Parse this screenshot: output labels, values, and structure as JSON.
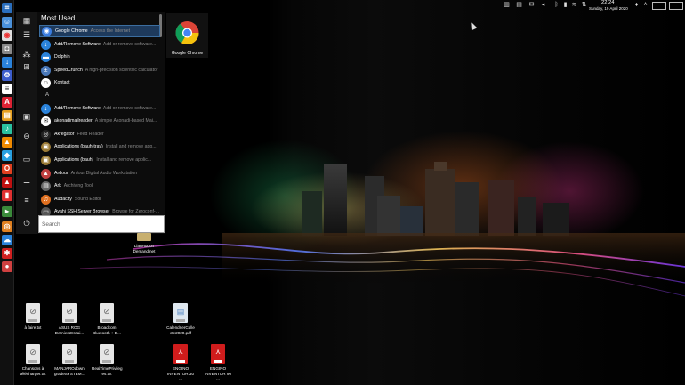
{
  "launcher": {
    "title": "Most Used",
    "section_letter": "A",
    "search_placeholder": "Search",
    "preview_label": "Google Chrome",
    "apps": [
      {
        "name": "Google Chrome",
        "desc": "Access the Internet",
        "icon": "chrome-icon",
        "color": "#3b7de0",
        "selected": true
      },
      {
        "name": "Add/Remove Software",
        "desc": "Add or remove software...",
        "icon": "download-icon",
        "color": "#2a82da",
        "selected": false
      },
      {
        "name": "Dolphin",
        "desc": "",
        "icon": "folder-icon",
        "color": "#2a82da",
        "selected": false
      },
      {
        "name": "SpeedCrunch",
        "desc": "A high-precision scientific calculator",
        "icon": "calculator-icon",
        "color": "#4a78b8",
        "selected": false
      },
      {
        "name": "Kontact",
        "desc": "",
        "icon": "contacts-icon",
        "color": "#fff",
        "selected": false
      },
      {
        "name": "Add/Remove Software",
        "desc": "Add or remove software...",
        "icon": "download-icon",
        "color": "#2a82da",
        "selected": false
      },
      {
        "name": "akonadimailreader",
        "desc": "A simple Akonadi-based Mai...",
        "icon": "mail-icon",
        "color": "#fff",
        "selected": false
      },
      {
        "name": "Akregator",
        "desc": "Feed Reader",
        "icon": "feed-icon",
        "color": "#222",
        "selected": false
      },
      {
        "name": "Applications (bauh-tray)",
        "desc": "Install and remove app...",
        "icon": "bauh-icon",
        "color": "#9a7a35",
        "selected": false
      },
      {
        "name": "Applications (bauh)",
        "desc": "Install and remove applic...",
        "icon": "bauh-icon",
        "color": "#9a7a35",
        "selected": false
      },
      {
        "name": "Ardour",
        "desc": "Ardour Digital Audio Workstation",
        "icon": "ardour-icon",
        "color": "#c04040",
        "selected": false
      },
      {
        "name": "Ark",
        "desc": "Archiving Tool",
        "icon": "archive-icon",
        "color": "#666",
        "selected": false
      },
      {
        "name": "Audacity",
        "desc": "Sound Editor",
        "icon": "audio-icon",
        "color": "#e07020",
        "selected": false
      },
      {
        "name": "Avahi SSH Server Browser",
        "desc": "Browse for Zeroconf-...",
        "icon": "network-icon",
        "color": "#555",
        "selected": false
      }
    ]
  },
  "tray": {
    "time": "22:24",
    "date": "Sunday, 19 April 2020"
  },
  "desktop": {
    "files": [
      {
        "name": "LianHudon Demandinet",
        "type": "folder"
      },
      {
        "name": "à faire.txt",
        "type": "txt"
      },
      {
        "name": "ASUS ROG DerniersEssai...",
        "type": "txt"
      },
      {
        "name": "Broadcom Bluetooth + D...",
        "type": "txt"
      },
      {
        "name": "CalendrierColle cte2020.pdf",
        "type": "pdf-doc"
      },
      {
        "name": "Chansons à télécharger.txt",
        "type": "txt"
      },
      {
        "name": "MANJAROdown gradeSYSTEM...",
        "type": "txt"
      },
      {
        "name": "RealTimePrivileg es.txt",
        "type": "txt"
      },
      {
        "name": "ENGINO INVENTOR 30 ...",
        "type": "pdf"
      },
      {
        "name": "ENGINO INVENTOR 90 ...",
        "type": "pdf"
      }
    ]
  }
}
